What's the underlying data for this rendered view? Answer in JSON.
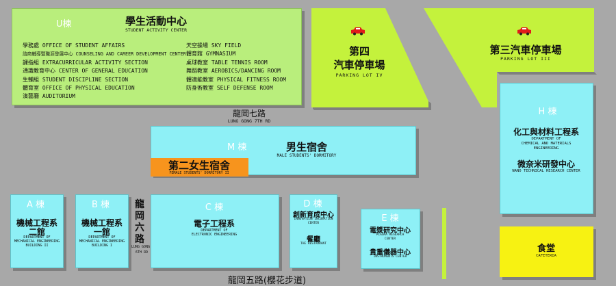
{
  "u_bldg": {
    "label": "U棟",
    "title_zh": "學生活動中心",
    "title_en": "STUDENT ACTIVITY CENTER",
    "left_items": [
      "學務處 OFFICE OF STUDENT AFFAIRS",
      "諮商輔導暨職涯發展中心 COUNSELING AND CAREER DEVELOPMENT CENTER",
      "課指組 EXTRACURRICULAR ACTIVITY SECTION",
      "通識教育中心 CENTER OF GENERAL EDUCATION",
      "生輔組 STUDENT DISCIPLINE SECTION",
      "體育室 OFFICE OF PHYSICAL EDUCATION",
      "演藝廳 AUDITORIUM"
    ],
    "right_items": [
      "天空操場 SKY FIELD",
      "體育館 GYMNASIUM",
      "桌球教室 TABLE TENNIS ROOM",
      "舞蹈教室 AEROBICS/DANCING ROOM",
      "體適能教室 PHYSICAL FITNESS ROOM",
      "防身術教室 SELF DEFENSE ROOM"
    ]
  },
  "parking4": {
    "zh_line1": "第四",
    "zh_line2": "汽車停車場",
    "en": "PARKING LOT IV"
  },
  "parking3": {
    "zh": "第三汽車停車場",
    "en": "PARKING LOT III"
  },
  "road7": {
    "zh": "龍岡七路",
    "en": "LUNG GONG 7TH RD"
  },
  "road6": {
    "zh1": "龍",
    "zh2": "岡",
    "zh3": "六",
    "zh4": "路",
    "en1": "LUNG GONG",
    "en2": "6TH RD"
  },
  "road5": {
    "zh": "龍岡五路(櫻花步道)"
  },
  "m_bldg": {
    "label": "M 棟",
    "title_zh": "男生宿舍",
    "title_en": "MALE STUDENTS' DORMITORY"
  },
  "dorm2": {
    "zh": "第二女生宿舍",
    "en": "FEMALE STUDENTS' DORMITORY II"
  },
  "h_bldg": {
    "label": "H 棟",
    "dept_zh": "化工與材料工程系",
    "dept_en1": "DEPARTMENT OF",
    "dept_en2": "CHEMICAL AND MATERIALS",
    "dept_en3": "ENGINEERING",
    "nano_zh": "微奈米研發中心",
    "nano_en": "NANO TECHNICAL RESEARCH CENTER"
  },
  "a_bldg": {
    "label": "A 棟",
    "zh1": "機械工程系",
    "zh2": "二館",
    "en1": "DEPARTMENT OF",
    "en2": "MECHANICAL ENGINEERING",
    "en3": "BUILDING II"
  },
  "b_bldg": {
    "label": "B 棟",
    "zh1": "機械工程系",
    "zh2": "一館",
    "en1": "DEPARTMENT OF",
    "en2": "MECHANICAL ENGINEERING",
    "en3": "BUILDING I"
  },
  "c_bldg": {
    "label": "C 棟",
    "zh": "電子工程系",
    "en1": "DEPARTMENT OF",
    "en2": "ELECTRONIC ENGINEERING"
  },
  "d_bldg": {
    "label": "D 棟",
    "inc_zh": "創新育成中心",
    "inc_en1": "INNOVATION INCUBATION",
    "inc_en2": "CENTER",
    "rest_zh": "餐廳",
    "rest_en": "THE RESTAURANT"
  },
  "e_bldg": {
    "label": "E 棟",
    "plasma_zh": "電漿研究中心",
    "plasma_en1": "PLASMA RESEARCH",
    "plasma_en2": "CENTER",
    "inst_zh": "貴重儀器中心",
    "inst_en": "INSTRUMENTS CENTER"
  },
  "cafeteria": {
    "zh": "食堂",
    "en": "CAFETERIA"
  },
  "colors": {
    "green": "#b9ee7c",
    "cyan": "#8ef0f6",
    "lime": "#c4f23c",
    "orange": "#f7941d",
    "yellow": "#f7f212",
    "car": "#e11b1b"
  }
}
